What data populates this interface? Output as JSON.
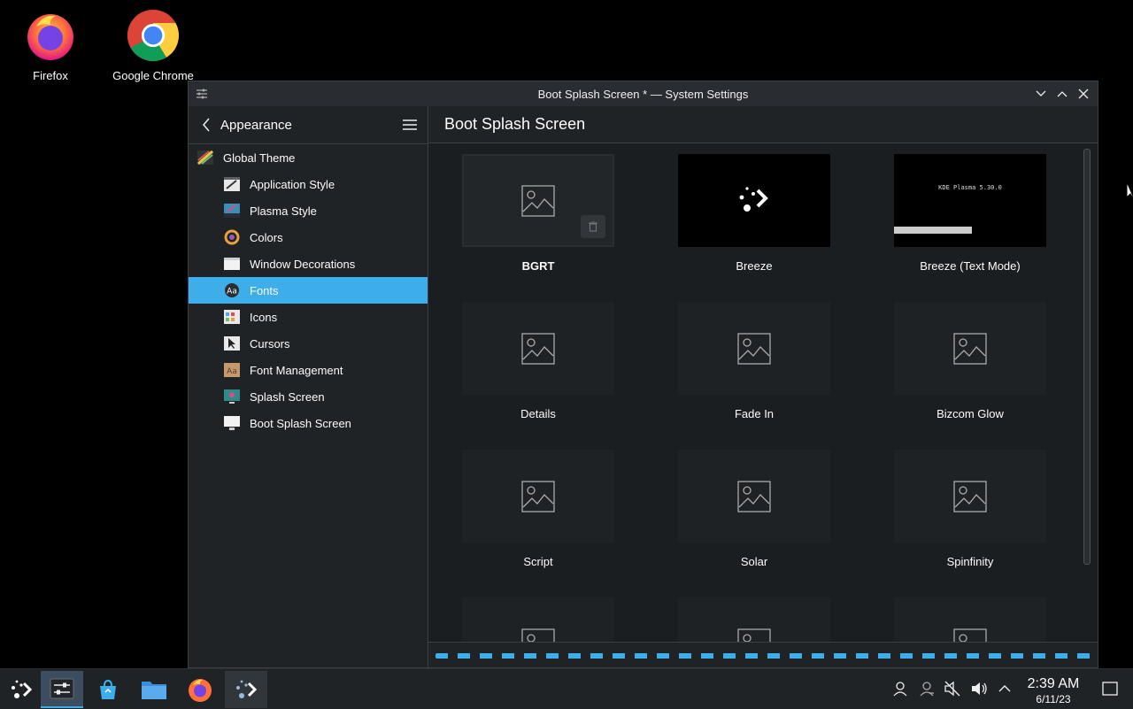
{
  "desktop": {
    "icons": [
      {
        "label": "Firefox"
      },
      {
        "label": "Google Chrome"
      }
    ]
  },
  "window": {
    "title": "Boot Splash Screen * — System Settings"
  },
  "sidebar": {
    "header": "Appearance",
    "items": [
      {
        "label": "Global Theme"
      },
      {
        "label": "Application Style"
      },
      {
        "label": "Plasma Style"
      },
      {
        "label": "Colors"
      },
      {
        "label": "Window Decorations"
      },
      {
        "label": "Fonts"
      },
      {
        "label": "Icons"
      },
      {
        "label": "Cursors"
      },
      {
        "label": "Font Management"
      },
      {
        "label": "Splash Screen"
      },
      {
        "label": "Boot Splash Screen"
      }
    ],
    "selected": "Fonts"
  },
  "main": {
    "title": "Boot Splash Screen",
    "themes": [
      {
        "label": "BGRT"
      },
      {
        "label": "Breeze"
      },
      {
        "label": "Breeze (Text Mode)",
        "preview_text": "KDE Plasma 5.30.0"
      },
      {
        "label": "Details"
      },
      {
        "label": "Fade In"
      },
      {
        "label": "Bizcom Glow"
      },
      {
        "label": "Script"
      },
      {
        "label": "Solar"
      },
      {
        "label": "Spinfinity"
      }
    ],
    "selected_theme": "BGRT"
  },
  "taskbar": {
    "time": "2:39 AM",
    "date": "6/11/23"
  },
  "colors": {
    "accent": "#3daee9",
    "window_bg": "#202326",
    "content_bg": "#1b1e20"
  }
}
